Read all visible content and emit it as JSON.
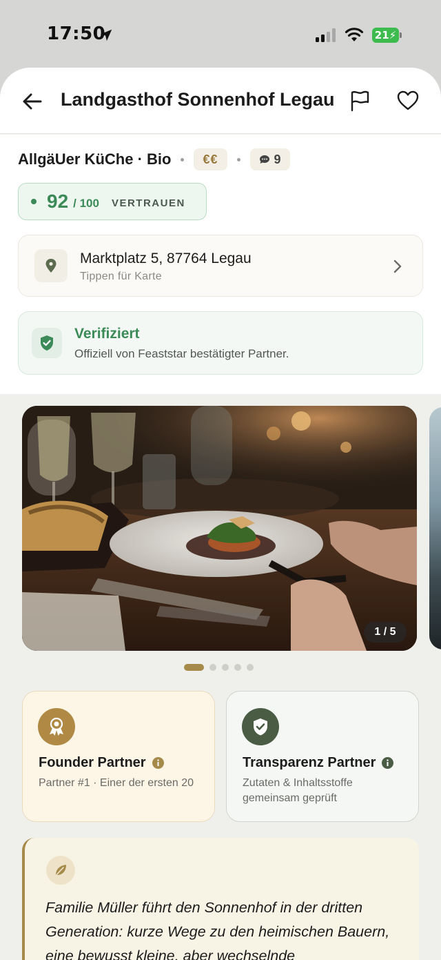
{
  "status_bar": {
    "time": "17:50",
    "battery": "21",
    "battery_color": "#3dbb4f"
  },
  "header": {
    "title": "Landgasthof Sonnenhof Legau",
    "back_icon": "arrow-left-icon",
    "report_icon": "flag-icon",
    "favorite_icon": "heart-icon"
  },
  "info": {
    "cuisine": "AllgäUer KüChe · Bio",
    "price": "€€",
    "comments": "9"
  },
  "trust": {
    "score": "92",
    "max": "/ 100",
    "label": "VERTRAUEN",
    "color": "#3b8a57"
  },
  "address": {
    "line": "Marktplatz 5, 87764 Legau",
    "hint": "Tippen für Karte"
  },
  "verified": {
    "title": "Verifiziert",
    "subtitle": "Offiziell von Feaststar bestätigter Partner."
  },
  "gallery": {
    "counter": "1 / 5",
    "current": 1,
    "total": 5
  },
  "partners": [
    {
      "title": "Founder Partner",
      "description": "Partner #1 · Einer der ersten 20",
      "icon": "award-ribbon-icon",
      "accent": "#b08a45"
    },
    {
      "title": "Transparenz Partner",
      "description": "Zutaten & Inhaltsstoffe gemeinsam geprüft",
      "icon": "shield-check-icon",
      "accent": "#4a5d44"
    }
  ],
  "story": {
    "icon": "leaf-icon",
    "text": "Familie Müller führt den Sonnenhof in der dritten Generation: kurze Wege zu den heimischen Bauern, eine bewusst kleine, aber wechselnde"
  }
}
